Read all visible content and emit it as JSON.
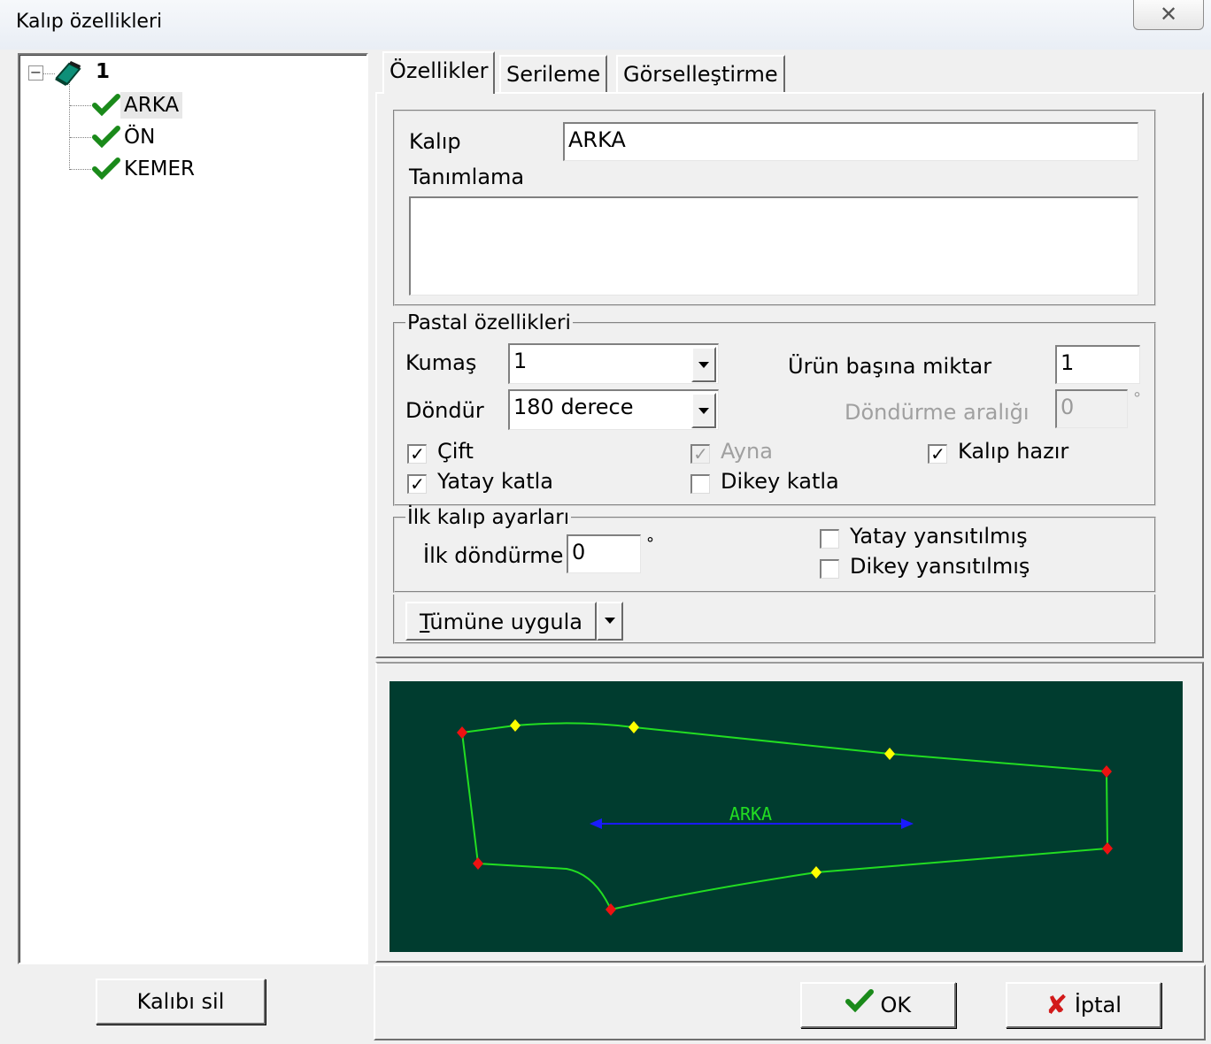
{
  "window": {
    "title": "Kalıp özellikleri",
    "close_glyph": "✕"
  },
  "tree": {
    "root": {
      "label": "1",
      "expander": "−"
    },
    "items": [
      {
        "label": "ARKA",
        "selected": true
      },
      {
        "label": "ÖN",
        "selected": false
      },
      {
        "label": "KEMER",
        "selected": false
      }
    ],
    "check_color": "#1a8a1a"
  },
  "left_buttons": {
    "delete_label": "Kalıbı sil"
  },
  "tabs": [
    {
      "label": "Özellikler",
      "active": true
    },
    {
      "label": "Serileme",
      "active": false
    },
    {
      "label": "Görselleştirme",
      "active": false
    }
  ],
  "pattern": {
    "name_label": "Kalıp",
    "name_value": "ARKA",
    "description_label": "Tanımlama",
    "description_value": ""
  },
  "pastal": {
    "legend": "Pastal özellikleri",
    "fabric_label": "Kumaş",
    "fabric_value": "1",
    "rotate_label": "Döndür",
    "rotate_value": "180 derece",
    "qty_label": "Ürün başına miktar",
    "qty_value": "1",
    "rotate_interval_label": "Döndürme aralığı",
    "rotate_interval_value": "0",
    "degree_symbol": "°",
    "checkboxes": {
      "cift": {
        "label": "Çift",
        "checked": true,
        "enabled": true
      },
      "ayna": {
        "label": "Ayna",
        "checked": true,
        "enabled": false
      },
      "kalip_hazir": {
        "label": "Kalıp hazır",
        "checked": true,
        "enabled": true
      },
      "yatay_katla": {
        "label": "Yatay katla",
        "checked": true,
        "enabled": true
      },
      "dikey_katla": {
        "label": "Dikey katla",
        "checked": false,
        "enabled": true
      }
    }
  },
  "initial": {
    "legend": "İlk kalıp ayarları",
    "rotation_label": "İlk döndürme",
    "rotation_value": "0",
    "degree_symbol": "°",
    "yatay_yansitilmis": {
      "label": "Yatay yansıtılmış",
      "checked": false
    },
    "dikey_yansitilmis": {
      "label": "Dikey yansıtılmış",
      "checked": false
    }
  },
  "apply_all": {
    "label_prefix": "T",
    "label_rest": "ümüne uygula"
  },
  "preview": {
    "label": "ARKA",
    "background": "#003c2f",
    "outline_color": "#22dd22",
    "grainline_color": "#1a1aff",
    "corner_color": "#ee1111",
    "midpoint_color": "#ffff00"
  },
  "footer": {
    "ok_label": "OK",
    "cancel_label": "İptal"
  }
}
